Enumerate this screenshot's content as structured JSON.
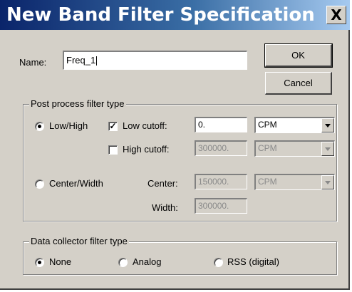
{
  "window": {
    "title": "New Band Filter Specification",
    "close_label": "X"
  },
  "name_field": {
    "label": "Name:",
    "value": "Freq_1"
  },
  "buttons": {
    "ok": "OK",
    "cancel": "Cancel"
  },
  "post_process": {
    "group_title": "Post process filter type",
    "low_high": {
      "label": "Low/High",
      "selected": true
    },
    "low_cutoff": {
      "label": "Low cutoff:",
      "checked": true,
      "value": "0.",
      "unit": "CPM"
    },
    "high_cutoff": {
      "label": "High cutoff:",
      "checked": false,
      "value": "300000.",
      "unit": "CPM"
    },
    "center_width": {
      "label": "Center/Width",
      "selected": false
    },
    "center": {
      "label": "Center:",
      "value": "150000.",
      "unit": "CPM"
    },
    "width": {
      "label": "Width:",
      "value": "300000."
    }
  },
  "data_collector": {
    "group_title": "Data collector filter type",
    "options": [
      {
        "label": "None",
        "selected": true
      },
      {
        "label": "Analog",
        "selected": false
      },
      {
        "label": "RSS (digital)",
        "selected": false
      }
    ]
  },
  "colors": {
    "dialog_bg": "#d4d0c8",
    "title_start": "#0a246a",
    "title_end": "#a6caf0"
  }
}
